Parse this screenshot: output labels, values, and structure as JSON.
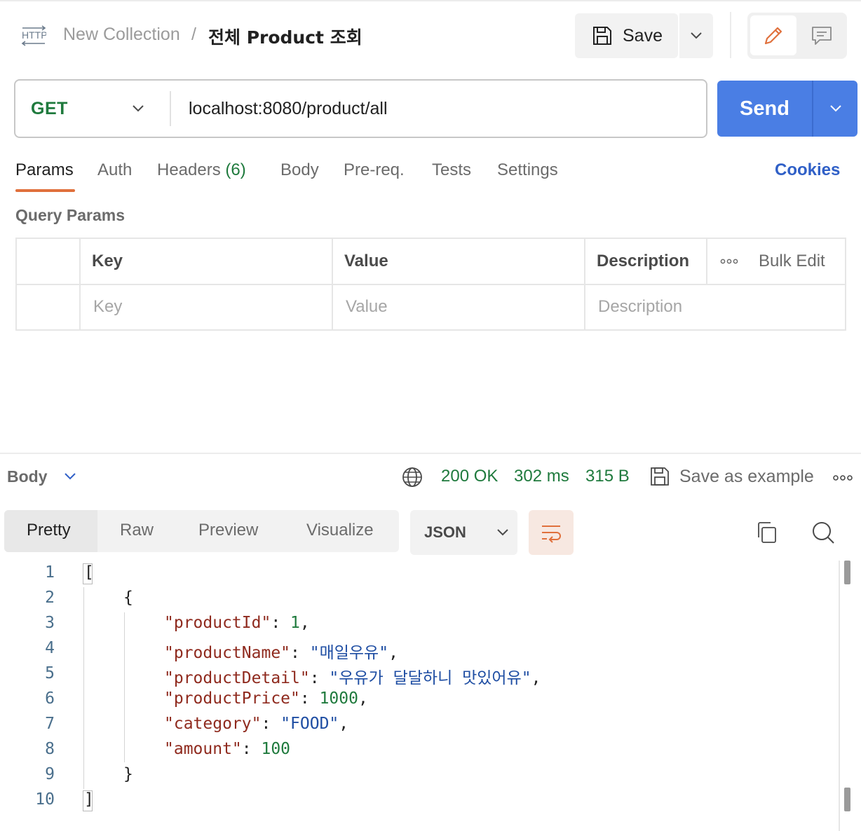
{
  "breadcrumb": {
    "protocol_icon": "http-icon",
    "collection": "New Collection",
    "separator": "/",
    "request_name": "전체 Product 조회"
  },
  "toolbar": {
    "save_label": "Save"
  },
  "request": {
    "method": "GET",
    "url": "localhost:8080/product/all",
    "send_label": "Send"
  },
  "request_tabs": {
    "params": "Params",
    "auth": "Auth",
    "headers": "Headers",
    "headers_count": "(6)",
    "body": "Body",
    "prereq": "Pre-req.",
    "tests": "Tests",
    "settings": "Settings",
    "cookies": "Cookies",
    "active": "Params"
  },
  "query_params": {
    "title": "Query Params",
    "columns": {
      "key": "Key",
      "value": "Value",
      "description": "Description",
      "bulk_edit": "Bulk Edit"
    },
    "placeholders": {
      "key": "Key",
      "value": "Value",
      "description": "Description"
    }
  },
  "response": {
    "body_label": "Body",
    "status": "200 OK",
    "time": "302 ms",
    "size": "315 B",
    "save_example": "Save as example",
    "view_tabs": {
      "pretty": "Pretty",
      "raw": "Raw",
      "preview": "Preview",
      "visualize": "Visualize",
      "active": "Pretty"
    },
    "format": "JSON",
    "code_lines": {
      "l1": "1",
      "l2": "2",
      "l3": "3",
      "l4": "4",
      "l5": "5",
      "l6": "6",
      "l7": "7",
      "l8": "8",
      "l9": "9",
      "l10": "10"
    },
    "json": {
      "open_array": "[",
      "open_obj": "{",
      "productId_key": "\"productId\"",
      "productId_val": "1",
      "productName_key": "\"productName\"",
      "productName_val": "\"매일우유\"",
      "productDetail_key": "\"productDetail\"",
      "productDetail_val": "\"우유가 달달하니 맛있어유\"",
      "productPrice_key": "\"productPrice\"",
      "productPrice_val": "1000",
      "category_key": "\"category\"",
      "category_val": "\"FOOD\"",
      "amount_key": "\"amount\"",
      "amount_val": "100",
      "close_obj": "}",
      "close_array": "]"
    }
  },
  "colors": {
    "accent_orange": "#e0703c",
    "send_blue": "#4a7ee4",
    "status_green": "#1f7a3d",
    "cookies_blue": "#3060c7"
  }
}
